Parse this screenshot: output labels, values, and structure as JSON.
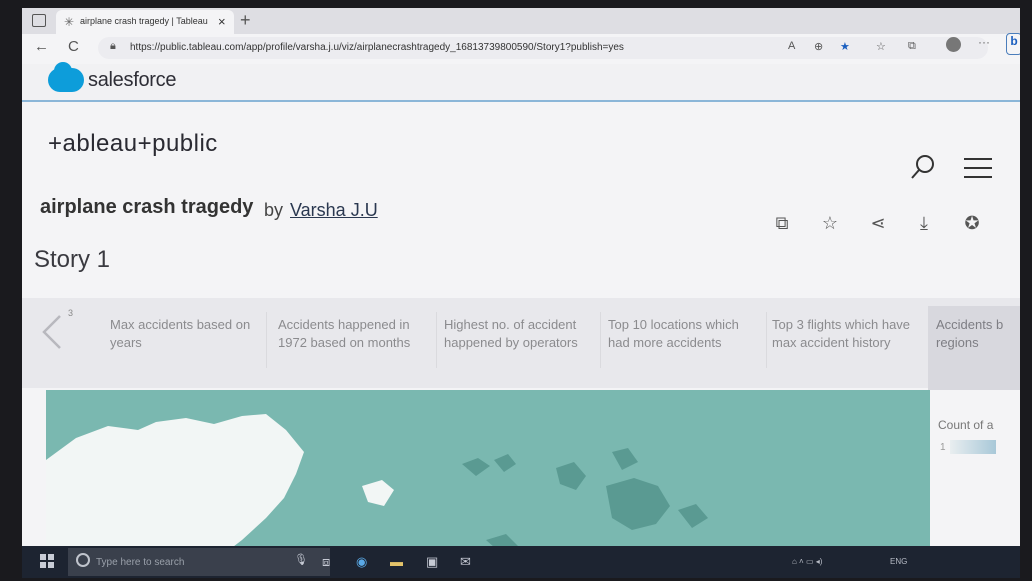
{
  "browser": {
    "tab_title": "airplane crash tragedy | Tableau",
    "tab_close": "×",
    "new_tab": "+",
    "back": "←",
    "refresh": "C",
    "url": "https://public.tableau.com/app/profile/varsha.j.u/viz/airplanecrashtragedy_16813739800590/Story1?publish=yes",
    "nav_icons": [
      "read-aloud-icon",
      "zoom-icon",
      "favorite-star-icon",
      "favorites-icon",
      "collections-icon",
      "profile-icon",
      "more-icon",
      "bing-icon"
    ],
    "bing_label": "b",
    "more_label": "···"
  },
  "salesforce": {
    "brand": "salesforce"
  },
  "tableau": {
    "logo_text": "+ableau+public"
  },
  "viz": {
    "title": "airplane crash tragedy",
    "by": "by",
    "author": "Varsha J.U",
    "story_title": "Story 1"
  },
  "story_points": {
    "prev_number": "3",
    "points": [
      "Max accidents based on years",
      "Accidents happened in 1972 based on months",
      "Highest no. of accident happened by operators",
      "Top 10 locations which had more accidents",
      "Top 3 flights which have max accident history",
      "Accidents b regions"
    ],
    "active_index": 5
  },
  "legend": {
    "title": "Count of a",
    "value": "1"
  },
  "taskbar": {
    "search_placeholder": "Type here to search",
    "tray_lang": "ENG"
  },
  "colors": {
    "map_sea": "#7ab8b0",
    "map_land": "#ffffff",
    "accent": "#0d9dda"
  }
}
